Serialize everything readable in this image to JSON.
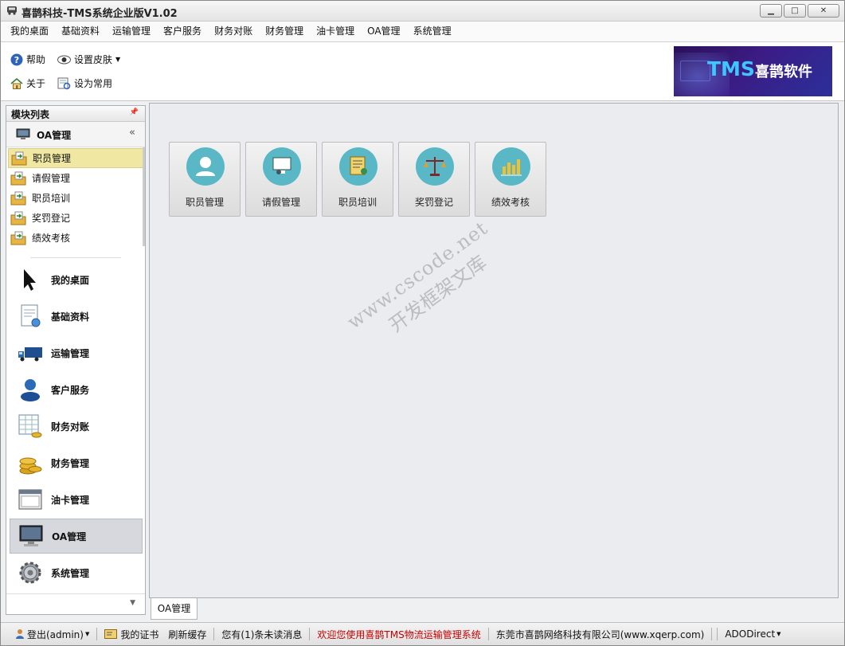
{
  "window": {
    "title": "喜鹊科技-TMS系统企业版V1.02",
    "controls": {
      "minimize": "▁",
      "maximize": "□",
      "close": "✕"
    }
  },
  "menubar": [
    "我的桌面",
    "基础资料",
    "运输管理",
    "客户服务",
    "财务对账",
    "财务管理",
    "油卡管理",
    "OA管理",
    "系统管理"
  ],
  "toolbar": {
    "help": "帮助",
    "skin": "设置皮肤",
    "about": "关于",
    "favorite": "设为常用",
    "banner_tms": "TMS",
    "banner_brand": "喜鹊软件"
  },
  "sidebar": {
    "header": "模块列表",
    "group": "OA管理",
    "group_items": [
      "职员管理",
      "请假管理",
      "职员培训",
      "奖罚登记",
      "绩效考核"
    ],
    "selected_item": "职员管理",
    "nav": [
      {
        "label": "我的桌面",
        "icon": "cursor-icon"
      },
      {
        "label": "基础资料",
        "icon": "document-icon"
      },
      {
        "label": "运输管理",
        "icon": "truck-icon"
      },
      {
        "label": "客户服务",
        "icon": "user-icon"
      },
      {
        "label": "财务对账",
        "icon": "spreadsheet-icon"
      },
      {
        "label": "财务管理",
        "icon": "coins-icon"
      },
      {
        "label": "油卡管理",
        "icon": "window-icon"
      },
      {
        "label": "OA管理",
        "icon": "monitor-icon"
      },
      {
        "label": "系统管理",
        "icon": "gear-icon"
      }
    ],
    "selected_nav": "OA管理"
  },
  "tiles": [
    {
      "label": "职员管理",
      "icon": "person-icon"
    },
    {
      "label": "请假管理",
      "icon": "computer-gear-icon"
    },
    {
      "label": "职员培训",
      "icon": "certificate-icon"
    },
    {
      "label": "奖罚登记",
      "icon": "scales-icon"
    },
    {
      "label": "绩效考核",
      "icon": "bar-chart-icon"
    }
  ],
  "tabs": [
    "OA管理"
  ],
  "watermark": {
    "line1": "www.cscode.net",
    "line2": "开发框架文库"
  },
  "statusbar": {
    "logout": "登出(admin)",
    "cert": "我的证书",
    "refresh": "刷新缓存",
    "messages": "您有(1)条未读消息",
    "welcome": "欢迎您使用喜鹊TMS物流运输管理系统",
    "company": "东莞市喜鹊网络科技有限公司(www.xqerp.com)",
    "db": "ADODirect"
  },
  "colors": {
    "accent_tile": "#5ab7c5",
    "selected_item": "#efe7a2",
    "welcome_text": "#c30000"
  }
}
